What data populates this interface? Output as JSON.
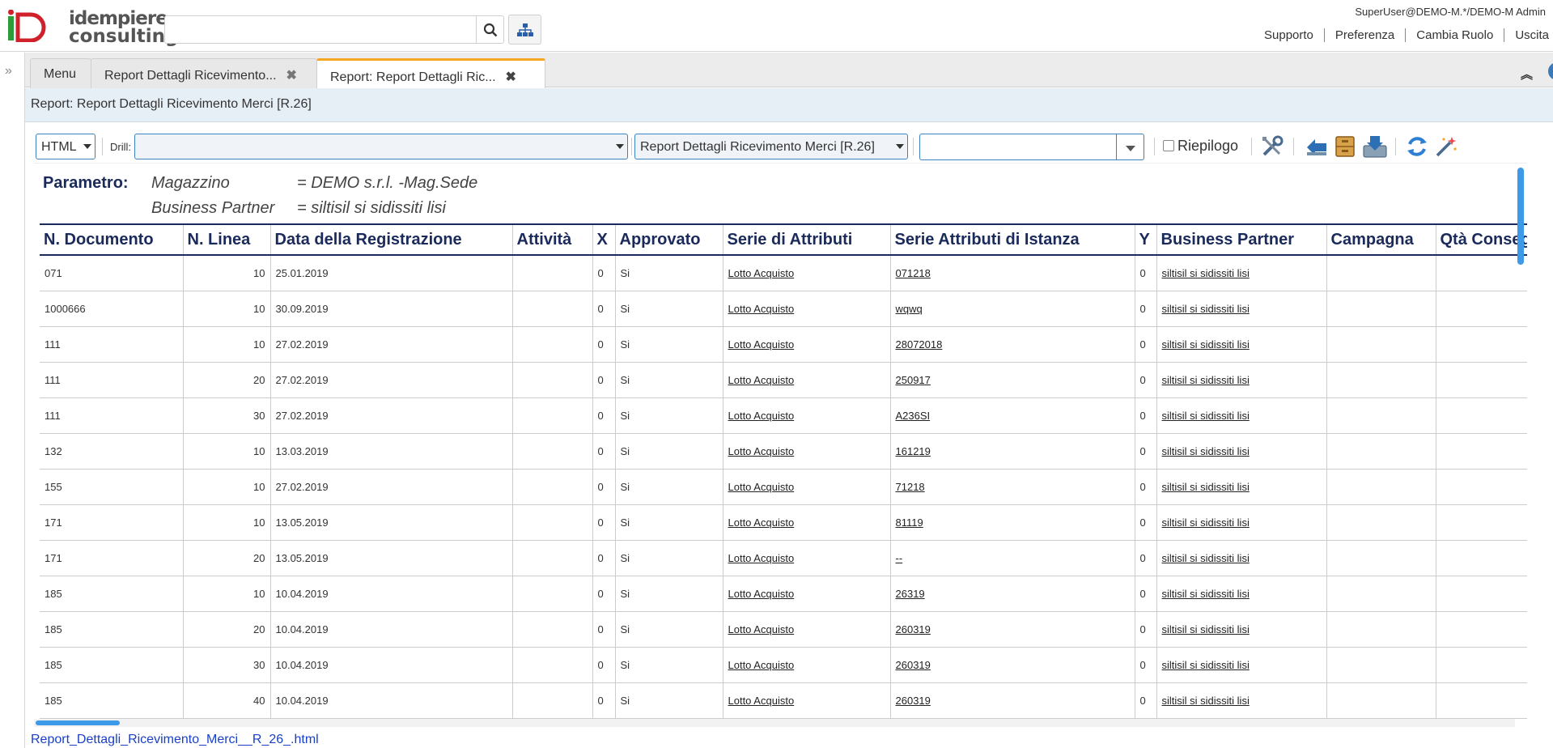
{
  "header": {
    "logo_line1": "idempiere",
    "logo_line2": "consulting",
    "search_placeholder": "",
    "user": "SuperUser@DEMO-M.*/DEMO-M Admin",
    "links": [
      "Supporto",
      "Preferenza",
      "Cambia Ruolo",
      "Uscita"
    ]
  },
  "tabs": [
    {
      "label": "Menu"
    },
    {
      "label": "Report Dettagli Ricevimento..."
    },
    {
      "label": "Report: Report Dettagli Ric..."
    }
  ],
  "window_title": "Report: Report Dettagli Ricevimento Merci [R.26]",
  "toolbar": {
    "format": "HTML",
    "drill_label": "Drill:",
    "drill_value": "",
    "print_format": "Report Dettagli Ricevimento Merci [R.26]",
    "combo_value": "",
    "summary_label": "Riepilogo",
    "summary_checked": false
  },
  "params": {
    "label": "Parametro:",
    "rows": [
      {
        "name": "Magazzino",
        "value": "= DEMO s.r.l. -Mag.Sede"
      },
      {
        "name": "Business Partner",
        "value": "= siltisil si sidissiti lisi"
      }
    ]
  },
  "table": {
    "columns": [
      "N. Documento",
      "N. Linea",
      "Data della Registrazione",
      "Attività",
      "X",
      "Approvato",
      "Serie di Attributi",
      "Serie Attributi di Istanza",
      "Y",
      "Business Partner",
      "Campagna",
      "Qtà Consegnata"
    ],
    "rows": [
      [
        "071",
        "10",
        "25.01.2019",
        "",
        "0",
        "Si",
        "Lotto Acquisto",
        "071218",
        "0",
        "siltisil si sidissiti lisi",
        "",
        ""
      ],
      [
        "1000666",
        "10",
        "30.09.2019",
        "",
        "0",
        "Si",
        "Lotto Acquisto",
        "wqwq",
        "0",
        "siltisil si sidissiti lisi",
        "",
        ""
      ],
      [
        "111",
        "10",
        "27.02.2019",
        "",
        "0",
        "Si",
        "Lotto Acquisto",
        "28072018",
        "0",
        "siltisil si sidissiti lisi",
        "",
        ""
      ],
      [
        "111",
        "20",
        "27.02.2019",
        "",
        "0",
        "Si",
        "Lotto Acquisto",
        "250917",
        "0",
        "siltisil si sidissiti lisi",
        "",
        ""
      ],
      [
        "111",
        "30",
        "27.02.2019",
        "",
        "0",
        "Si",
        "Lotto Acquisto",
        "A236SI",
        "0",
        "siltisil si sidissiti lisi",
        "",
        ""
      ],
      [
        "132",
        "10",
        "13.03.2019",
        "",
        "0",
        "Si",
        "Lotto Acquisto",
        "161219",
        "0",
        "siltisil si sidissiti lisi",
        "",
        ""
      ],
      [
        "155",
        "10",
        "27.02.2019",
        "",
        "0",
        "Si",
        "Lotto Acquisto",
        "71218",
        "0",
        "siltisil si sidissiti lisi",
        "",
        ""
      ],
      [
        "171",
        "10",
        "13.05.2019",
        "",
        "0",
        "Si",
        "Lotto Acquisto",
        "81119",
        "0",
        "siltisil si sidissiti lisi",
        "",
        ""
      ],
      [
        "171",
        "20",
        "13.05.2019",
        "",
        "0",
        "Si",
        "Lotto Acquisto",
        "--",
        "0",
        "siltisil si sidissiti lisi",
        "",
        ""
      ],
      [
        "185",
        "10",
        "10.04.2019",
        "",
        "0",
        "Si",
        "Lotto Acquisto",
        "26319",
        "0",
        "siltisil si sidissiti lisi",
        "",
        ""
      ],
      [
        "185",
        "20",
        "10.04.2019",
        "",
        "0",
        "Si",
        "Lotto Acquisto",
        "260319",
        "0",
        "siltisil si sidissiti lisi",
        "",
        ""
      ],
      [
        "185",
        "30",
        "10.04.2019",
        "",
        "0",
        "Si",
        "Lotto Acquisto",
        "260319",
        "0",
        "siltisil si sidissiti lisi",
        "",
        ""
      ],
      [
        "185",
        "40",
        "10.04.2019",
        "",
        "0",
        "Si",
        "Lotto Acquisto",
        "260319",
        "0",
        "siltisil si sidissiti lisi",
        "",
        ""
      ]
    ]
  },
  "file_link": "Report_Dettagli_Ricevimento_Merci__R_26_.html",
  "colors": {
    "accent": "#3d9ae8",
    "tab_active_border": "#f5a623",
    "header_text": "#1a2a5a",
    "logo_red": "#d0202a",
    "logo_green": "#2e9b3a"
  }
}
